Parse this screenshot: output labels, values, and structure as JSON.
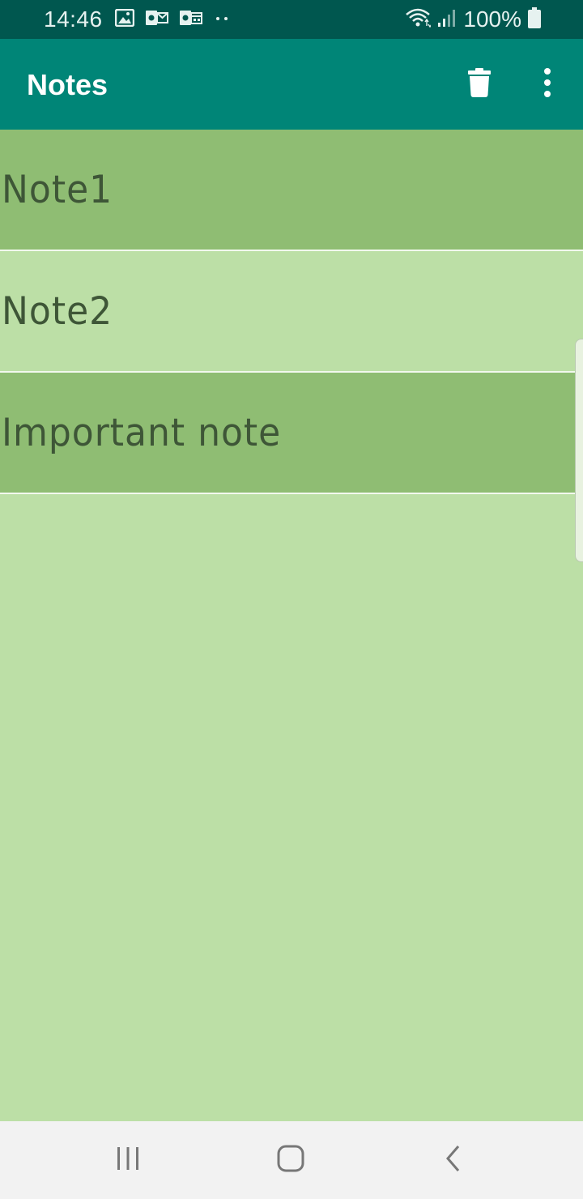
{
  "status_bar": {
    "time": "14:46",
    "battery": "100%",
    "left_icons": [
      "image-icon",
      "outlook-mail-icon",
      "outlook-calendar-icon",
      "more-notifications-icon"
    ],
    "right_icons": [
      "wifi-icon",
      "signal-icon",
      "battery-icon"
    ]
  },
  "app_bar": {
    "title": "Notes",
    "actions": [
      "trash-icon",
      "overflow-menu-icon"
    ],
    "color": "#008577"
  },
  "notes": [
    {
      "title": "Note1",
      "shade": "dark"
    },
    {
      "title": "Note2",
      "shade": "light"
    },
    {
      "title": "Important note",
      "shade": "dark"
    }
  ],
  "colors": {
    "status_bar": "#00574f",
    "row_dark": "#8fbd73",
    "row_light": "#bcdfa6",
    "note_text": "#3e5637"
  },
  "nav_bar": {
    "buttons": [
      "recent-apps-icon",
      "home-icon",
      "back-icon"
    ]
  }
}
